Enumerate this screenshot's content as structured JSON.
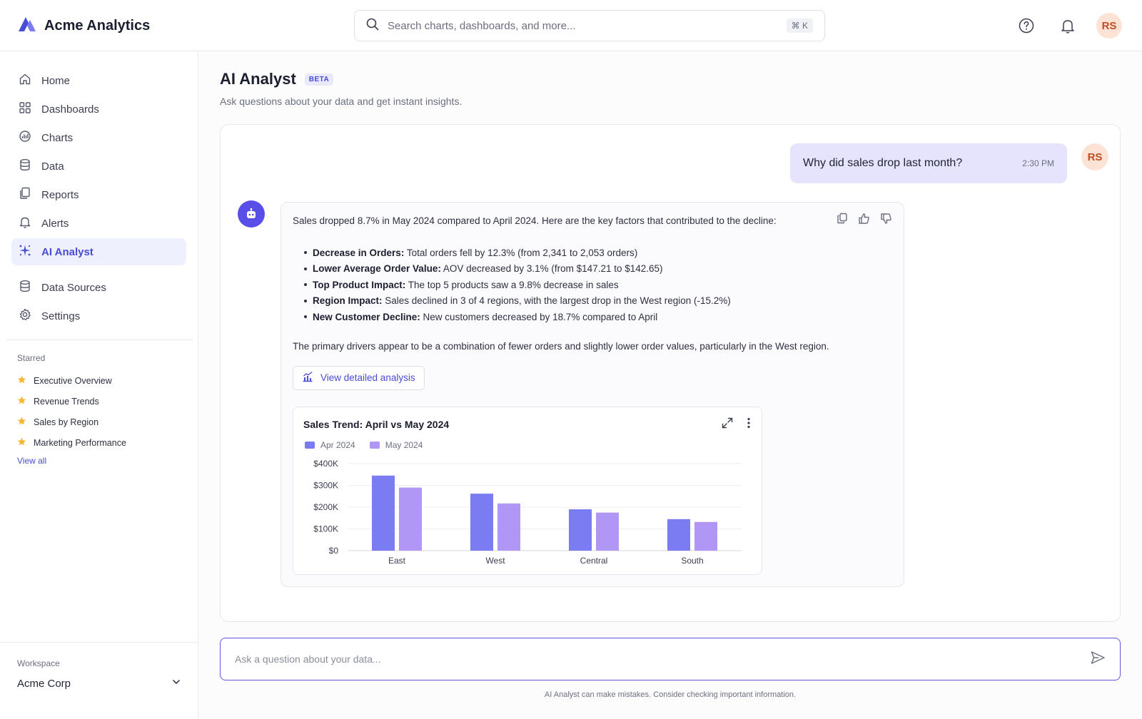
{
  "app": {
    "name": "Acme Analytics",
    "accent": "#4a4bd6"
  },
  "search": {
    "placeholder": "Search charts, dashboards, and more...",
    "shortcut": "⌘ K"
  },
  "user": {
    "initials": "RS"
  },
  "sidebar": {
    "items": [
      {
        "label": "Home",
        "icon": "home-icon"
      },
      {
        "label": "Dashboards",
        "icon": "grid-icon"
      },
      {
        "label": "Charts",
        "icon": "chart-icon"
      },
      {
        "label": "Data",
        "icon": "database-icon"
      },
      {
        "label": "Reports",
        "icon": "report-icon"
      },
      {
        "label": "Alerts",
        "icon": "bell-icon"
      },
      {
        "label": "AI Analyst",
        "icon": "sparkle-icon",
        "active": true
      },
      {
        "label": "Data Sources",
        "icon": "database-icon"
      },
      {
        "label": "Settings",
        "icon": "gear-icon"
      }
    ],
    "starred_title": "Starred",
    "starred": [
      "Executive Overview",
      "Revenue Trends",
      "Sales by Region",
      "Marketing Performance"
    ],
    "view_all": "View all",
    "workspace_label": "Workspace",
    "workspace_name": "Acme Corp"
  },
  "page": {
    "title": "AI Analyst",
    "badge": "BETA",
    "subtitle": "Ask questions about your data and get instant insights."
  },
  "chat": {
    "user_message": "Why did sales drop last month?",
    "user_time": "2:30 PM",
    "user_initials": "RS",
    "bot_intro": "Sales dropped 8.7% in May 2024 compared to April 2024. Here are the key factors that contributed to the decline:",
    "bullets": [
      {
        "label": "Decrease in Orders:",
        "text": " Total orders fell by 12.3% (from 2,341 to 2,053 orders)"
      },
      {
        "label": "Lower Average Order Value:",
        "text": " AOV decreased by 3.1% (from $147.21 to $142.65)"
      },
      {
        "label": "Top Product Impact:",
        "text": " The top 5 products saw a 9.8% decrease in sales"
      },
      {
        "label": "Region Impact:",
        "text": " Sales declined in 3 of 4 regions, with the largest drop in the West region (-15.2%)"
      },
      {
        "label": "New Customer Decline:",
        "text": " New customers decreased by 18.7% compared to April"
      }
    ],
    "summary": "The primary drivers appear to be a combination of fewer orders and slightly lower order values, particularly in the West region.",
    "analysis_button": "View detailed analysis"
  },
  "chart_data": {
    "type": "bar",
    "title": "Sales Trend: April vs May 2024",
    "categories": [
      "East",
      "West",
      "Central",
      "South"
    ],
    "series": [
      {
        "name": "Apr 2024",
        "color": "#7b7cf2",
        "values": [
          345000,
          262000,
          190000,
          145000
        ]
      },
      {
        "name": "May 2024",
        "color": "#b197f5",
        "values": [
          290000,
          217000,
          175000,
          132000
        ]
      }
    ],
    "yticks": [
      "$0",
      "$100K",
      "$200K",
      "$300K",
      "$400K"
    ],
    "ylim": [
      0,
      400000
    ],
    "grid": true,
    "legend": "top-left"
  },
  "composer": {
    "placeholder": "Ask a question about your data..."
  },
  "disclaimer": "AI Analyst can make mistakes. Consider checking important information."
}
